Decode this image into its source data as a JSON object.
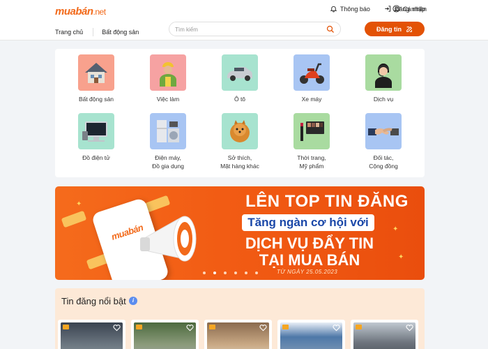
{
  "header": {
    "logo": {
      "brand": "muabán",
      "tld": ".net"
    },
    "links": [
      {
        "label": "Thông báo",
        "icon": "bell-icon"
      },
      {
        "label": "Đăng nhập",
        "icon": "login-icon"
      },
      {
        "label": "Cá nhân",
        "icon": "user-icon"
      }
    ],
    "nav": [
      {
        "label": "Trang chủ"
      },
      {
        "label": "Bất động sản"
      }
    ],
    "search": {
      "placeholder": "Tìm kiếm",
      "value": ""
    },
    "post_button": "Đăng tin"
  },
  "categories": [
    {
      "label": "Bất động sản",
      "icon": "house-icon",
      "bg": "#f8a18d"
    },
    {
      "label": "Việc làm",
      "icon": "worker-icon",
      "bg": "#f6a2a2"
    },
    {
      "label": "Ô tô",
      "icon": "car-icon",
      "bg": "#a7e3cf"
    },
    {
      "label": "Xe máy",
      "icon": "scooter-icon",
      "bg": "#a8c5f3"
    },
    {
      "label": "Dịch vụ",
      "icon": "support-agent-icon",
      "bg": "#a9dba0"
    },
    {
      "label": "Đồ điện tử",
      "icon": "computer-icon",
      "bg": "#a7e3cf"
    },
    {
      "label": "Điện máy,\nĐồ gia dụng",
      "line1": "Điện máy,",
      "line2": "Đồ gia dụng",
      "icon": "appliances-icon",
      "bg": "#a8c5f3"
    },
    {
      "label": "Sở thích,\nMặt hàng khác",
      "line1": "Sở thích,",
      "line2": "Mặt hàng khác",
      "icon": "dog-icon",
      "bg": "#a7e3cf"
    },
    {
      "label": "Thời trang,\nMỹ phẩm",
      "line1": "Thời trang,",
      "line2": "Mỹ phẩm",
      "icon": "cosmetics-icon",
      "bg": "#a9dba0"
    },
    {
      "label": "Đối tác,\nCộng đồng",
      "line1": "Đối tác,",
      "line2": "Cộng đồng",
      "icon": "handshake-icon",
      "bg": "#a8c5f3"
    }
  ],
  "banner": {
    "title": "LÊN TOP TIN ĐĂNG",
    "subtitle": "Tăng ngàn cơ hội với",
    "line1": "DỊCH VỤ ĐẨY TIN",
    "line2": "TẠI MUA BÁN",
    "date": "TỪ NGÀY 25.05.2023",
    "phone_logo": "muabán",
    "slide_count": 6,
    "active_slide": 2
  },
  "featured": {
    "title": "Tin đăng nổi bật",
    "info_icon": "info-icon",
    "items": [
      {
        "tag": "VIP",
        "color": "#5d6b78"
      },
      {
        "tag": "VIP",
        "color": "#7c8a6a"
      },
      {
        "tag": "VIP",
        "color": "#8a6a4e"
      },
      {
        "tag": "VIP",
        "color": "#4e78a8"
      },
      {
        "tag": "VIP",
        "color": "#6d747d"
      }
    ]
  },
  "colors": {
    "accent": "#e35205",
    "brand": "#f26a1b"
  }
}
